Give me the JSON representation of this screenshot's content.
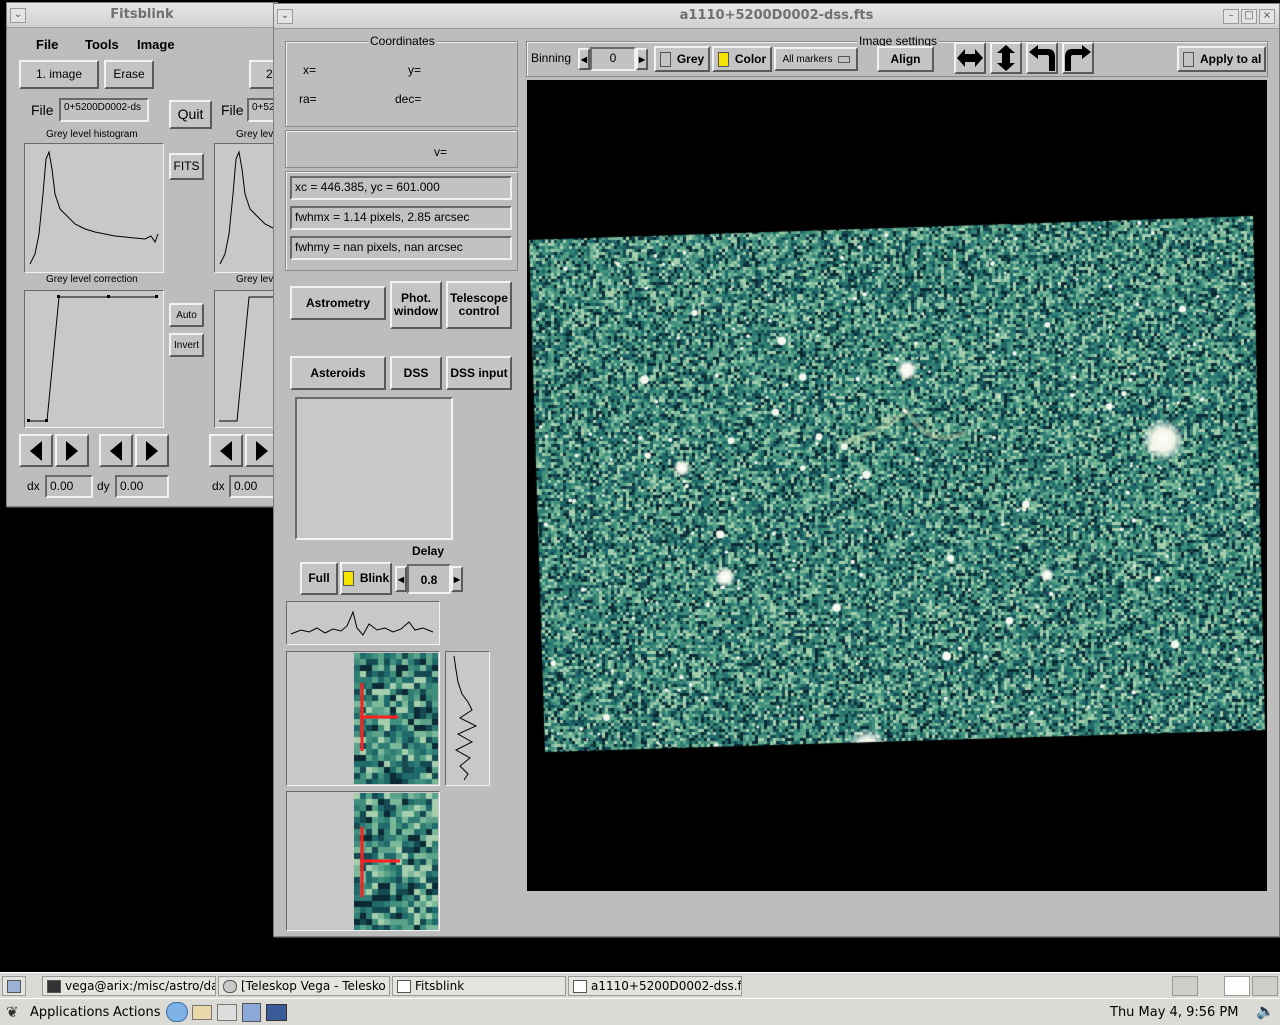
{
  "fitsblink_window": {
    "title": "Fitsblink",
    "menu": [
      "File",
      "Tools",
      "Image"
    ],
    "image1_button": "1. image",
    "erase_button": "Erase",
    "image2_button": "2",
    "file_label": "File",
    "file_value": "0+5200D0002-ds",
    "file_label_2": "File",
    "file_value_2": "0+52",
    "quit_button": "Quit",
    "fits_button": "FITS",
    "histogram_label": "Grey level histogram",
    "histogram_label_2": "Grey lev",
    "correction_label": "Grey level correction",
    "correction_label_2": "Grey lev",
    "auto_button": "Auto",
    "invert_button": "Invert",
    "dx_label": "dx",
    "dx_value": "0.00",
    "dy_label": "dy",
    "dy_value": "0.00",
    "dx_label_2": "dx",
    "dx_value_2": "0.00"
  },
  "main_window": {
    "title": "a1110+5200D0002-dss.fts",
    "coordinates": {
      "group_label": "Coordinates",
      "x_label": "x=",
      "y_label": "y=",
      "ra_label": "ra=",
      "dec_label": "dec=",
      "v_label": "v="
    },
    "measurements": {
      "centroid": "xc =  446.385, yc =  601.000",
      "fwhmx": "fwhmx =     1.14 pixels,     2.85 arcsec",
      "fwhmy": "fwhmy =     nan pixels,     nan arcsec"
    },
    "buttons": {
      "astrometry": "Astrometry",
      "phot_window": "Phot.\nwindow",
      "telescope_control": "Telescope\ncontrol",
      "asteroids": "Asteroids",
      "dss": "DSS",
      "dss_input": "DSS input",
      "full": "Full",
      "blink": "Blink"
    },
    "delay": {
      "label": "Delay",
      "value": "0.8"
    },
    "image_settings": {
      "group_label": "Image settings",
      "binning_label": "Binning",
      "binning_value": "0",
      "grey_label": "Grey",
      "color_label": "Color",
      "markers_option": "All markers",
      "align_button": "Align",
      "apply_label": "Apply to al"
    }
  },
  "taskbar": {
    "tasks": [
      "vega@arix:/misc/astro/da",
      "[Teleskop Vega - Telesko",
      "Fitsblink",
      "a1110+5200D0002-dss.fts"
    ],
    "applications_menu": "Applications",
    "actions_menu": "Actions",
    "clock": "Thu May  4,  9:56 PM"
  },
  "colors": {
    "window_bg": "#bdbdbd",
    "star_field": "#2f7d73",
    "highlight": "#f5e400",
    "crosshair": "#ff2020"
  }
}
